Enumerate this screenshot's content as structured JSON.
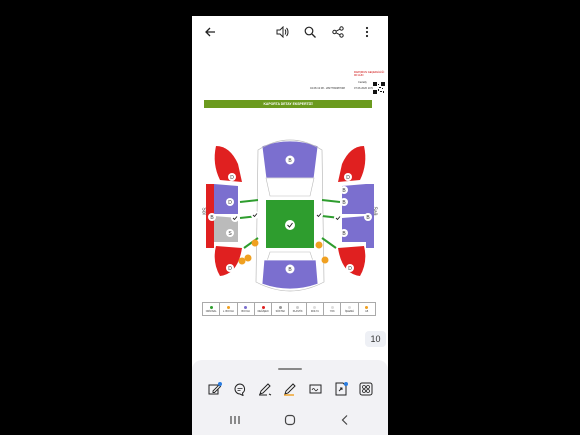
{
  "toolbar": {
    "icons": [
      "back-arrow-icon",
      "speaker-icon",
      "search-icon",
      "share-icon",
      "more-vert-icon"
    ]
  },
  "document": {
    "red_note": "RAPORUN GEÇERLİLİĞİ: 90 GÜN",
    "header_left": "04.08.13:38 - 2827782087098",
    "header_right_1": "Cartally",
    "header_right_2": "07.06.2026 10:56",
    "banner": "KAPORTA DETAY EKSPERTİZİ",
    "left_side": "Sol",
    "right_side": "Sağ",
    "legend": [
      {
        "label": "ORİJİNAL",
        "color": "#2e9d2e"
      },
      {
        "label": "L. BOYALI",
        "color": "#f0a020"
      },
      {
        "label": "BOYALI",
        "color": "#7b6fcf"
      },
      {
        "label": "DEĞİŞEN",
        "color": "#e02020"
      },
      {
        "label": "SÖKTAK",
        "color": "#999999"
      },
      {
        "label": "PLASTİK",
        "color": "#cccccc"
      },
      {
        "label": "DOLYU",
        "color": "#dddddd"
      },
      {
        "label": "YOK",
        "color": "#dddddd"
      },
      {
        "label": "İŞLEMLİ",
        "color": "#dddddd"
      },
      {
        "label": "LB",
        "color": "#f0a020"
      }
    ],
    "markers": {
      "b": "B",
      "d": "D",
      "s": "S"
    }
  },
  "page_number": "10",
  "bottom_tools": [
    "edit-icon",
    "comment-icon",
    "pen-icon",
    "text-highlight-icon",
    "signature-icon",
    "export-pdf-icon",
    "grid-icon"
  ],
  "nav": [
    "recent-apps-icon",
    "home-icon",
    "back-icon"
  ]
}
